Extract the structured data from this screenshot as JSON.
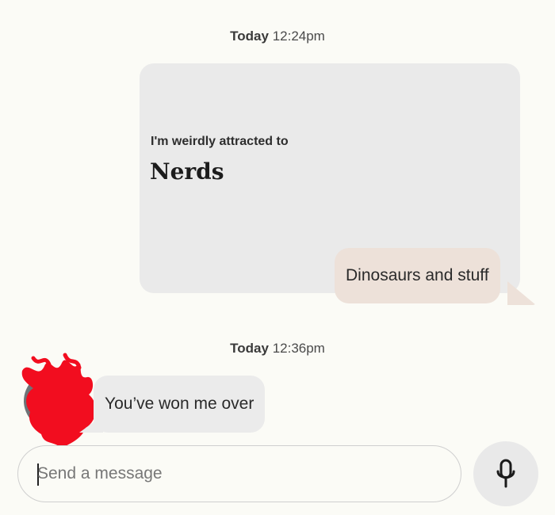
{
  "conversation": {
    "first_timestamp": {
      "day": "Today",
      "time": "12:24pm"
    },
    "prompt": {
      "question": "I'm weirdly attracted to",
      "answer": "Nerds"
    },
    "reply": "Dinosaurs and stuff",
    "second_timestamp": {
      "day": "Today",
      "time": "12:36pm"
    },
    "incoming": "You’ve won me over"
  },
  "composer": {
    "placeholder": "Send a message",
    "value": ""
  },
  "icons": {
    "mic": "microphone-icon",
    "avatar": "avatar-redacted"
  },
  "colors": {
    "background": "#fbfbf6",
    "prompt_card": "#eaeaea",
    "reply_bubble": "#ede1d9",
    "incoming_bubble": "#ebebeb",
    "redaction": "#f20d1f"
  }
}
